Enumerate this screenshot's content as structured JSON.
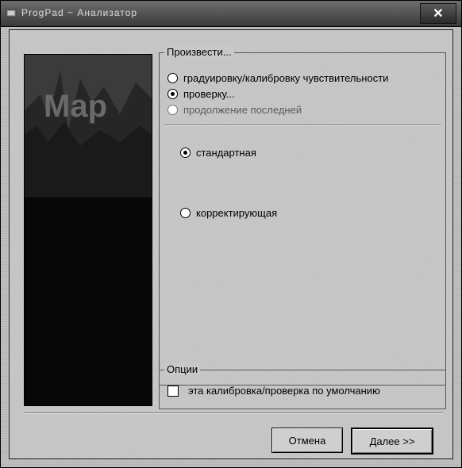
{
  "window": {
    "title": "ProgPad ~ Анализатор",
    "close_label": "✕"
  },
  "produce_group": {
    "label": "Произвести...",
    "options": [
      {
        "label": "градуировку/калибровку чувствительности",
        "checked": false,
        "enabled": true
      },
      {
        "label": "проверку...",
        "checked": true,
        "enabled": true
      },
      {
        "label": "продолжение последней",
        "checked": false,
        "enabled": false
      }
    ],
    "mode_options": [
      {
        "label": "стандартная",
        "checked": true
      },
      {
        "label": "корректирующая",
        "checked": false
      }
    ]
  },
  "options_group": {
    "label": "Опции",
    "checkbox_label": "эта калибровка/проверка по умолчанию",
    "checked": false
  },
  "buttons": {
    "cancel": "Отмена",
    "next": "Далее >>"
  },
  "banner": {
    "logo_text": "Map"
  }
}
